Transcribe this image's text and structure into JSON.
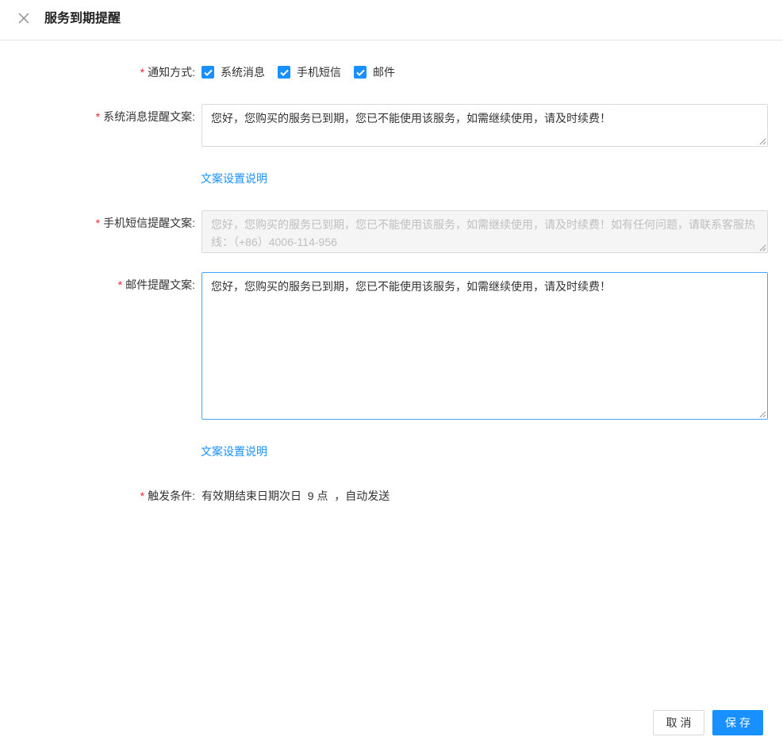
{
  "header": {
    "title": "服务到期提醒"
  },
  "form": {
    "notify_method": {
      "label": "通知方式",
      "options": [
        {
          "label": "系统消息",
          "checked": true
        },
        {
          "label": "手机短信",
          "checked": true
        },
        {
          "label": "邮件",
          "checked": true
        }
      ]
    },
    "system_message": {
      "label": "系统消息提醒文案",
      "value": "您好，您购买的服务已到期，您已不能使用该服务，如需继续使用，请及时续费！",
      "help_link": "文案设置说明"
    },
    "sms": {
      "label": "手机短信提醒文案",
      "value": "您好，您购买的服务已到期，您已不能使用该服务，如需继续使用，请及时续费！如有任何问题，请联系客服热线：（+86）4006-114-956",
      "disabled": true
    },
    "email": {
      "label": "邮件提醒文案",
      "value": "您好，您购买的服务已到期，您已不能使用该服务，如需继续使用，请及时续费！",
      "help_link": "文案设置说明"
    },
    "trigger": {
      "label": "触发条件",
      "value": "有效期结束日期次日  9 点  ，自动发送"
    },
    "label_suffix": ":"
  },
  "footer": {
    "cancel_label": "取消",
    "save_label": "保存"
  },
  "colors": {
    "primary": "#1890ff",
    "required": "#f5222d"
  },
  "icons": {
    "close": "close-icon",
    "checkbox": "checkmark-icon"
  }
}
